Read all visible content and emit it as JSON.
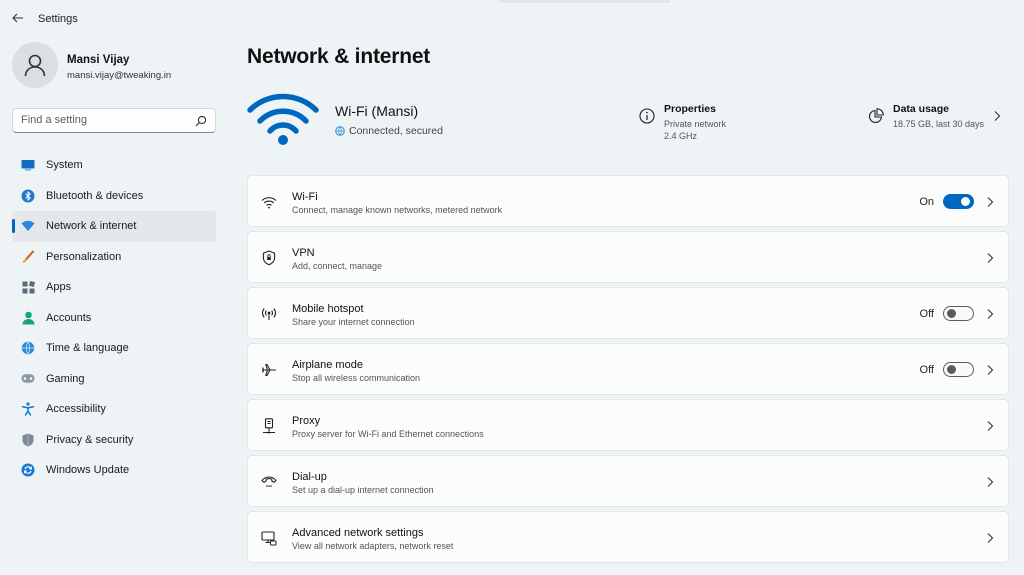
{
  "window": {
    "title": "Settings"
  },
  "profile": {
    "name": "Mansi Vijay",
    "email": "mansi.vijay@tweaking.in"
  },
  "search": {
    "placeholder": "Find a setting"
  },
  "sidebar": {
    "items": [
      {
        "label": "System",
        "icon": "system-icon",
        "active": false
      },
      {
        "label": "Bluetooth & devices",
        "icon": "bluetooth-icon",
        "active": false
      },
      {
        "label": "Network & internet",
        "icon": "network-icon",
        "active": true
      },
      {
        "label": "Personalization",
        "icon": "brush-icon",
        "active": false
      },
      {
        "label": "Apps",
        "icon": "apps-icon",
        "active": false
      },
      {
        "label": "Accounts",
        "icon": "accounts-icon",
        "active": false
      },
      {
        "label": "Time & language",
        "icon": "globe-clock-icon",
        "active": false
      },
      {
        "label": "Gaming",
        "icon": "gamepad-icon",
        "active": false
      },
      {
        "label": "Accessibility",
        "icon": "accessibility-icon",
        "active": false
      },
      {
        "label": "Privacy & security",
        "icon": "shield-icon",
        "active": false
      },
      {
        "label": "Windows Update",
        "icon": "update-icon",
        "active": false
      }
    ]
  },
  "main": {
    "title": "Network & internet",
    "hero": {
      "network_name": "Wi-Fi (Mansi)",
      "status": "Connected, secured",
      "properties": {
        "title": "Properties",
        "line1": "Private network",
        "line2": "2.4 GHz"
      },
      "data_usage": {
        "title": "Data usage",
        "subtitle": "18.75 GB, last 30 days"
      }
    },
    "cards": [
      {
        "title": "Wi-Fi",
        "subtitle": "Connect, manage known networks, metered network",
        "icon": "wifi-icon",
        "toggle": "On"
      },
      {
        "title": "VPN",
        "subtitle": "Add, connect, manage",
        "icon": "vpn-shield-icon",
        "toggle": null
      },
      {
        "title": "Mobile hotspot",
        "subtitle": "Share your internet connection",
        "icon": "hotspot-icon",
        "toggle": "Off"
      },
      {
        "title": "Airplane mode",
        "subtitle": "Stop all wireless communication",
        "icon": "airplane-icon",
        "toggle": "Off"
      },
      {
        "title": "Proxy",
        "subtitle": "Proxy server for Wi-Fi and Ethernet connections",
        "icon": "proxy-icon",
        "toggle": null
      },
      {
        "title": "Dial-up",
        "subtitle": "Set up a dial-up internet connection",
        "icon": "dialup-icon",
        "toggle": null
      },
      {
        "title": "Advanced network settings",
        "subtitle": "View all network adapters, network reset",
        "icon": "advanced-network-icon",
        "toggle": null
      }
    ]
  },
  "colors": {
    "accent": "#0067c0",
    "background": "#eef3f6",
    "card": "#fbfcfc"
  }
}
